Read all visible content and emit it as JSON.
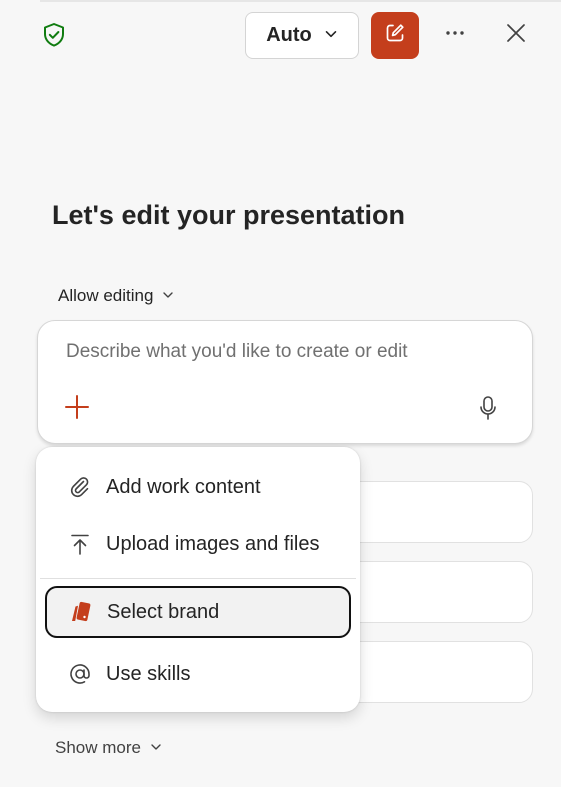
{
  "header": {
    "mode_label": "Auto",
    "icons": [
      "shield-check-icon",
      "chevron-down-icon",
      "compose-icon",
      "more-horizontal-icon",
      "close-icon"
    ],
    "accent_color": "#c43e1c",
    "shield_color": "#107c10"
  },
  "main": {
    "heading": "Let's edit your presentation",
    "permission_label": "Allow editing",
    "composer": {
      "placeholder": "Describe what you'd like to create or edit"
    },
    "show_more_label": "Show more"
  },
  "menu": {
    "items": [
      {
        "label": "Add work content",
        "icon": "paperclip-icon"
      },
      {
        "label": "Upload images and files",
        "icon": "upload-icon"
      },
      {
        "label": "Select brand",
        "icon": "brand-swatch-icon",
        "focused": true
      },
      {
        "label": "Use skills",
        "icon": "at-sign-icon"
      }
    ]
  }
}
